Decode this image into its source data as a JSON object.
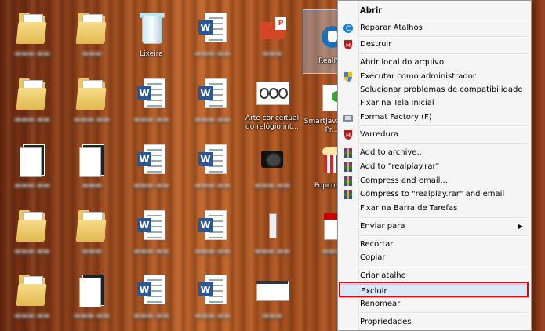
{
  "desktop": {
    "icons": {
      "recycle_bin": "Lixeira",
      "realplayer": "RealPl...",
      "arte": "Arte conceitual do relógio int...",
      "smartjava": "SmartJava Fixer Pr...",
      "popcorn": "Popcorn..."
    }
  },
  "context_menu": {
    "items": [
      {
        "label": "Abrir",
        "icon": "none",
        "bold": true
      },
      {
        "label": "Reparar Atalhos",
        "icon": "repair-icon"
      },
      {
        "label": "Destruir",
        "icon": "mcafee-shield-icon"
      },
      {
        "label": "Abrir local do arquivo",
        "icon": "none"
      },
      {
        "label": "Executar como administrador",
        "icon": "uac-shield-icon"
      },
      {
        "label": "Solucionar problemas de compatibilidade",
        "icon": "none"
      },
      {
        "label": "Fixar na Tela Inicial",
        "icon": "none"
      },
      {
        "label": "Format Factory (F)",
        "icon": "format-factory-icon"
      },
      {
        "label": "Varredura",
        "icon": "mcafee-shield-icon"
      },
      {
        "label": "Add to archive...",
        "icon": "winrar-icon"
      },
      {
        "label": "Add to \"realplay.rar\"",
        "icon": "winrar-icon"
      },
      {
        "label": "Compress and email...",
        "icon": "winrar-icon"
      },
      {
        "label": "Compress to \"realplay.rar\" and email",
        "icon": "winrar-icon"
      },
      {
        "label": "Fixar na Barra de Tarefas",
        "icon": "none"
      },
      {
        "label": "Enviar para",
        "icon": "none",
        "submenu": true
      },
      {
        "label": "Recortar",
        "icon": "none"
      },
      {
        "label": "Copiar",
        "icon": "none"
      },
      {
        "label": "Criar atalho",
        "icon": "none"
      },
      {
        "label": "Excluir",
        "icon": "none",
        "highlighted": true
      },
      {
        "label": "Renomear",
        "icon": "none"
      },
      {
        "label": "Propriedades",
        "icon": "none"
      }
    ],
    "submenu_arrow": "▶"
  },
  "colors": {
    "highlight_box": "#e00000",
    "menu_background": "#f5f5f5",
    "word_blue": "#2b5797",
    "mcafee_red": "#c01818"
  }
}
